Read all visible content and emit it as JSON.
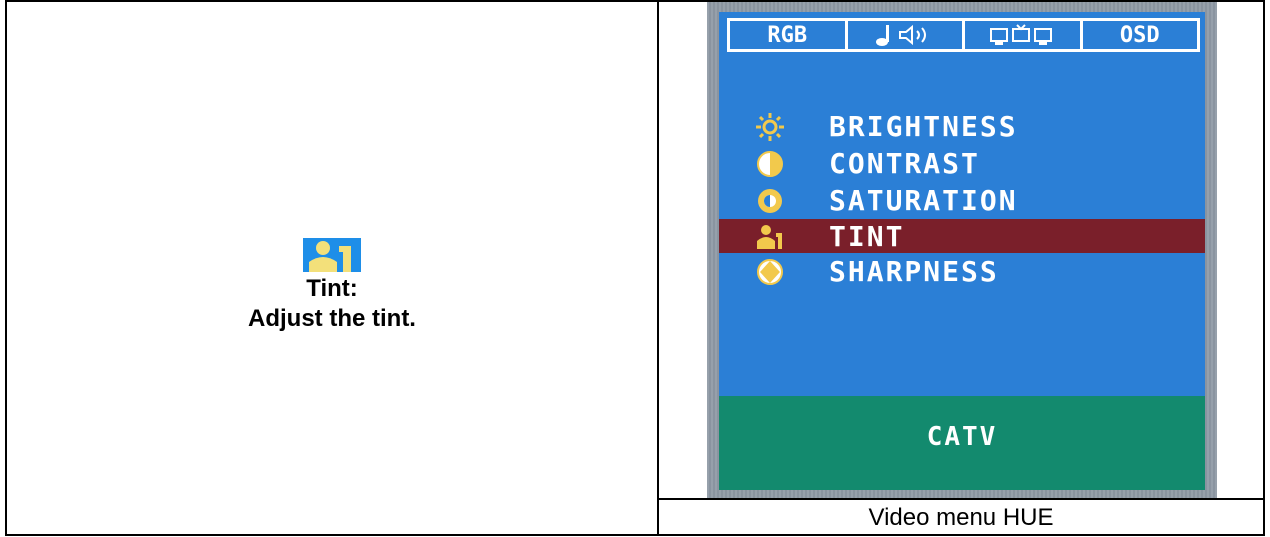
{
  "left": {
    "icon": "tint-person-1-icon",
    "title": "Tint:",
    "description": "Adjust the tint."
  },
  "osd": {
    "tabs": [
      {
        "label": "RGB",
        "icon": "rgb-tab-icon"
      },
      {
        "label": "",
        "icon": "audio-tab-icon"
      },
      {
        "label": "",
        "icon": "video-tab-icon"
      },
      {
        "label": "OSD",
        "icon": "osd-tab-icon"
      }
    ],
    "items": [
      {
        "label": "BRIGHTNESS",
        "icon": "sun-icon"
      },
      {
        "label": "CONTRAST",
        "icon": "contrast-icon"
      },
      {
        "label": "SATURATION",
        "icon": "saturation-icon"
      },
      {
        "label": "TINT",
        "icon": "tint-icon",
        "selected": true
      },
      {
        "label": "SHARPNESS",
        "icon": "sharpness-icon"
      }
    ],
    "footer": "CATV",
    "colors": {
      "screen": "#2b7fd6",
      "selected": "#7a1f2a",
      "footer": "#138a6e",
      "icon": "#f2c94c"
    }
  },
  "caption": "Video menu HUE"
}
